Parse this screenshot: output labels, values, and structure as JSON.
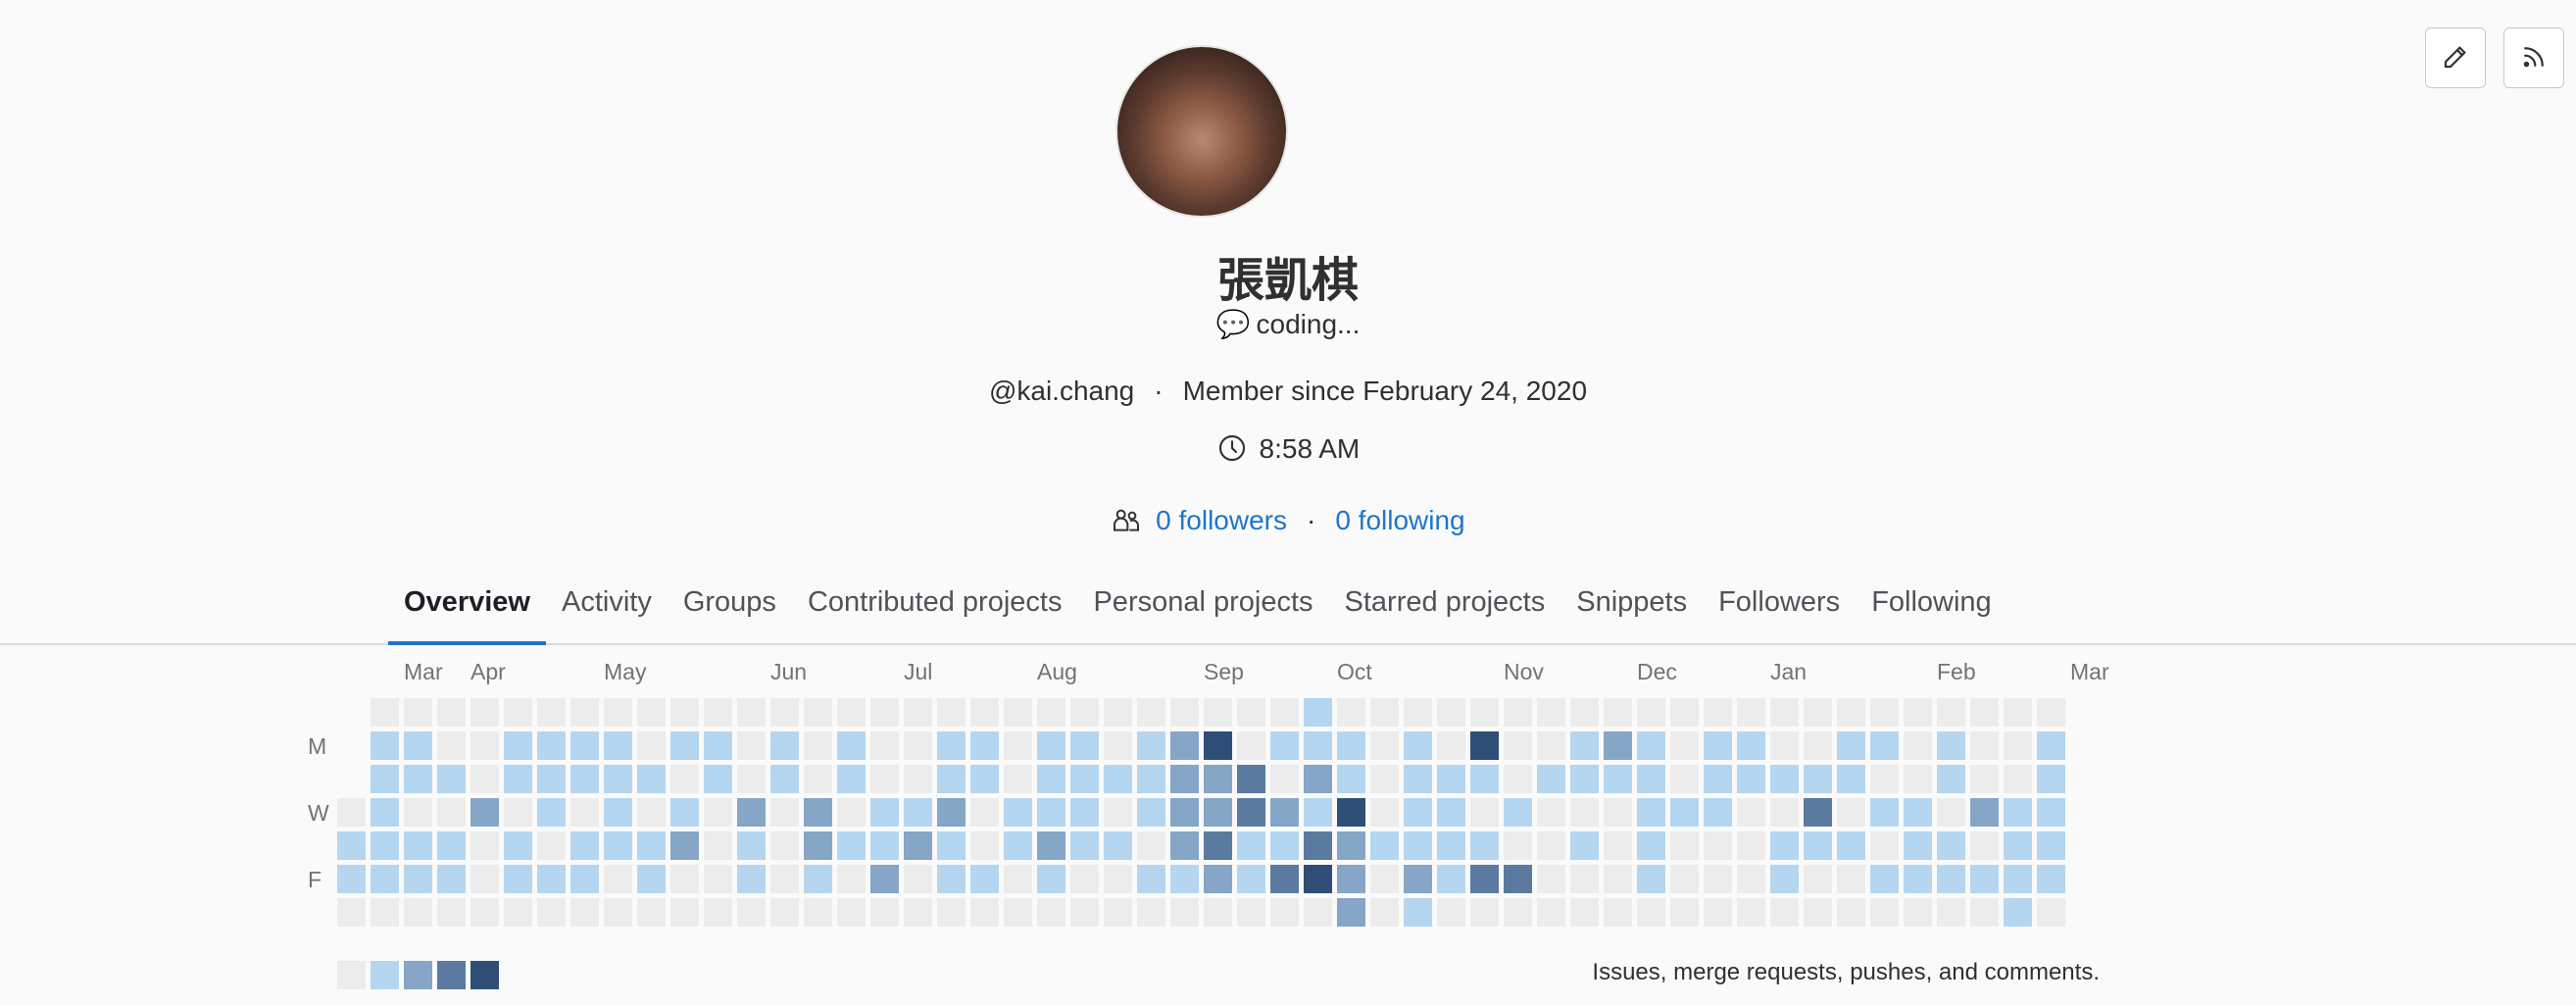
{
  "header_actions": [
    {
      "label": "",
      "icon": "pencil-icon"
    },
    {
      "label": "",
      "icon": "rss-icon"
    }
  ],
  "profile": {
    "name": "張凱棋",
    "status_emoji": "💬",
    "status_text": "coding...",
    "username": "@kai.chang",
    "member_since": "Member since February 24, 2020",
    "local_time": "8:58 AM",
    "followers": "0 followers",
    "following": "0 following",
    "meta_separator": "·"
  },
  "tabs": [
    {
      "label": "Overview",
      "active": true
    },
    {
      "label": "Activity"
    },
    {
      "label": "Groups"
    },
    {
      "label": "Contributed projects"
    },
    {
      "label": "Personal projects"
    },
    {
      "label": "Starred projects"
    },
    {
      "label": "Snippets"
    },
    {
      "label": "Followers"
    },
    {
      "label": "Following"
    }
  ],
  "calendar": {
    "months": [
      {
        "label": "Mar",
        "week": 1
      },
      {
        "label": "Apr",
        "week": 3
      },
      {
        "label": "May",
        "week": 7
      },
      {
        "label": "Jun",
        "week": 12
      },
      {
        "label": "Jul",
        "week": 16
      },
      {
        "label": "Aug",
        "week": 20
      },
      {
        "label": "Sep",
        "week": 25
      },
      {
        "label": "Oct",
        "week": 29
      },
      {
        "label": "Nov",
        "week": 34
      },
      {
        "label": "Dec",
        "week": 38
      },
      {
        "label": "Jan",
        "week": 42
      },
      {
        "label": "Feb",
        "week": 47
      },
      {
        "label": "Mar",
        "week": 51
      }
    ],
    "day_labels": [
      {
        "label": "M",
        "row": 1
      },
      {
        "label": "W",
        "row": 3
      },
      {
        "label": "F",
        "row": 5
      }
    ],
    "first_week_start_row": 4,
    "grid_rows": [
      "-000000000000000000000000000010000000000000000000000",
      "-110011110110101001101101240111010400121011001101001",
      "-111011111010101001101111223021011101111011111001001",
      "0100201010102020112011101223214011010001110030110211",
      "1111010111201021121012110231132111100101000111011011",
      "1111011101001010201101001121342021330001000100111111",
      "0000000000000000000000000000002010000000000000000010"
    ],
    "legend_levels": [
      0,
      1,
      2,
      3,
      4
    ],
    "legend_text": "Issues, merge requests, pushes, and comments.",
    "level_colors": [
      "#ececec",
      "#b5d6f1",
      "#85a6c6",
      "#5b7aa0",
      "#2e4e78"
    ]
  }
}
